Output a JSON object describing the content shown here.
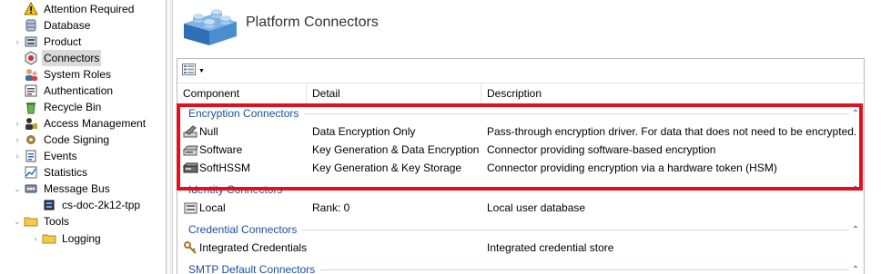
{
  "tree": {
    "items": [
      {
        "label": "Attention Required",
        "icon": "warning-icon",
        "expander": ""
      },
      {
        "label": "Database",
        "icon": "database-icon",
        "expander": ""
      },
      {
        "label": "Product",
        "icon": "product-icon",
        "expander": "›"
      },
      {
        "label": "Connectors",
        "icon": "connectors-icon",
        "expander": ""
      },
      {
        "label": "System Roles",
        "icon": "system-roles-icon",
        "expander": ""
      },
      {
        "label": "Authentication",
        "icon": "authentication-icon",
        "expander": ""
      },
      {
        "label": "Recycle Bin",
        "icon": "recycle-bin-icon",
        "expander": ""
      },
      {
        "label": "Access Management",
        "icon": "access-management-icon",
        "expander": "›"
      },
      {
        "label": "Code Signing",
        "icon": "code-signing-icon",
        "expander": "›"
      },
      {
        "label": "Events",
        "icon": "events-icon",
        "expander": "›"
      },
      {
        "label": "Statistics",
        "icon": "statistics-icon",
        "expander": ""
      },
      {
        "label": "Message Bus",
        "icon": "message-bus-icon",
        "expander": "⌄"
      },
      {
        "label": "cs-doc-2k12-tpp",
        "icon": "server-icon",
        "expander": ""
      },
      {
        "label": "Tools",
        "icon": "folder-icon",
        "expander": "⌄"
      },
      {
        "label": "Logging",
        "icon": "folder-icon",
        "expander": "›"
      }
    ],
    "selected": "Connectors"
  },
  "page": {
    "title": "Platform Connectors",
    "logo_icon": "blue-brick-icon",
    "view_button_icon": "view-grid-icon"
  },
  "columns": [
    "Component",
    "Detail",
    "Description"
  ],
  "groups": {
    "encryption": "Encryption Connectors",
    "identity": "Identity Connectors",
    "credential": "Credential Connectors",
    "smtp": "SMTP Default Connectors"
  },
  "rows": {
    "encryption": [
      {
        "component": "Null",
        "icon": "pencil-icon",
        "detail": "Data Encryption Only",
        "description": "Pass-through encryption driver. For data that does not need to be encrypted."
      },
      {
        "component": "Software",
        "icon": "software-key-icon",
        "detail": "Key Generation & Data Encryption",
        "description": "Connector providing software-based encryption"
      },
      {
        "component": "SoftHSSM",
        "icon": "hsm-icon",
        "detail": "Key Generation & Key Storage",
        "description": "Connector providing encryption via a hardware token (HSM)"
      }
    ],
    "identity": [
      {
        "component": "Local",
        "icon": "local-user-icon",
        "detail": "Rank: 0",
        "description": "Local user database"
      }
    ],
    "credential": [
      {
        "component": "Integrated Credentials",
        "icon": "keys-icon",
        "detail": "",
        "description": "Integrated credential store"
      }
    ]
  },
  "colors": {
    "highlight": "#e3101b",
    "group_text": "#1e4e9e",
    "selection": "#d9d9d9"
  }
}
